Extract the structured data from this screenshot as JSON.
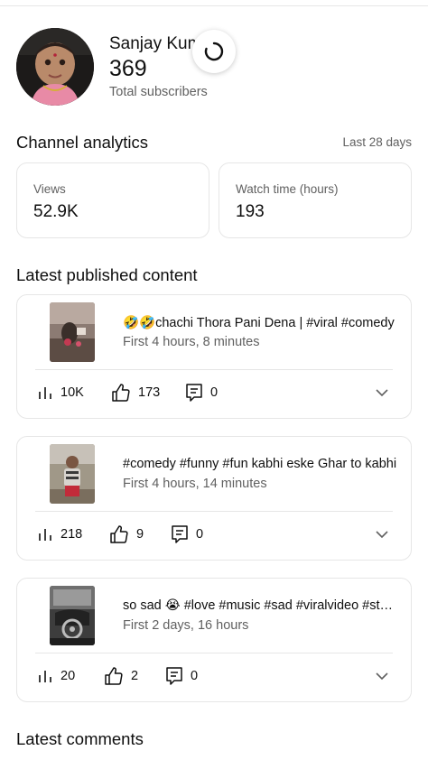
{
  "channel": {
    "name": "Sanjay Kum",
    "subscriber_count": "369",
    "subscriber_label": "Total subscribers"
  },
  "analytics": {
    "title": "Channel analytics",
    "range": "Last 28 days",
    "views_label": "Views",
    "views_value": "52.9K",
    "watch_label": "Watch time (hours)",
    "watch_value": "193"
  },
  "latest_content": {
    "title": "Latest published content",
    "items": [
      {
        "title": "🤣🤣chachi Thora Pani Dena | #viral #comedy",
        "age": "First 4 hours, 8 minutes",
        "views": "10K",
        "likes": "173",
        "comments": "0"
      },
      {
        "title": "#comedy #funny #fun  kabhi eske Ghar to kabhi",
        "age": "First 4 hours, 14 minutes",
        "views": "218",
        "likes": "9",
        "comments": "0"
      },
      {
        "title": "so sad 😭 #love #music #sad #viralvideo #status",
        "age": "First 2 days, 16 hours",
        "views": "20",
        "likes": "2",
        "comments": "0"
      }
    ]
  },
  "latest_comments": {
    "title": "Latest comments"
  },
  "icons": [
    "spinner-icon",
    "views-icon",
    "like-icon",
    "comment-icon",
    "chevron-down-icon"
  ]
}
